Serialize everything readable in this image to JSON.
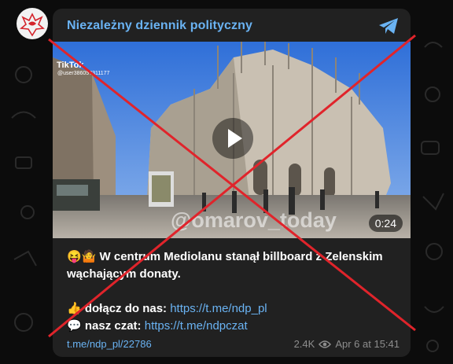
{
  "post": {
    "channel_title": "Niezależny dziennik polityczny",
    "media": {
      "tiktok_label": "TikTok",
      "tiktok_user": "@user38605?311177",
      "watermark": "@omarov_today",
      "duration": "0:24"
    },
    "text": {
      "headline_emoji": "😝🤷",
      "headline_part1": "W centrum Mediolanu stanął billboard z Zelenskim",
      "headline_part2": "wąchającym donaty.",
      "join_emoji": "👍",
      "join_label": "dołącz do nas:",
      "join_url": "https://t.me/ndp_pl",
      "chat_emoji": "💬",
      "chat_label": "nasz czat:",
      "chat_url": "https://t.me/ndpczat"
    },
    "footer": {
      "post_link": "t.me/ndp_pl/22786",
      "views": "2.4K",
      "date": "Apr 6 at 15:41"
    }
  },
  "colors": {
    "card_bg": "#212121",
    "link": "#6ab3f3",
    "cross": "#e0242b",
    "page_bg": "#0c0c0c"
  }
}
